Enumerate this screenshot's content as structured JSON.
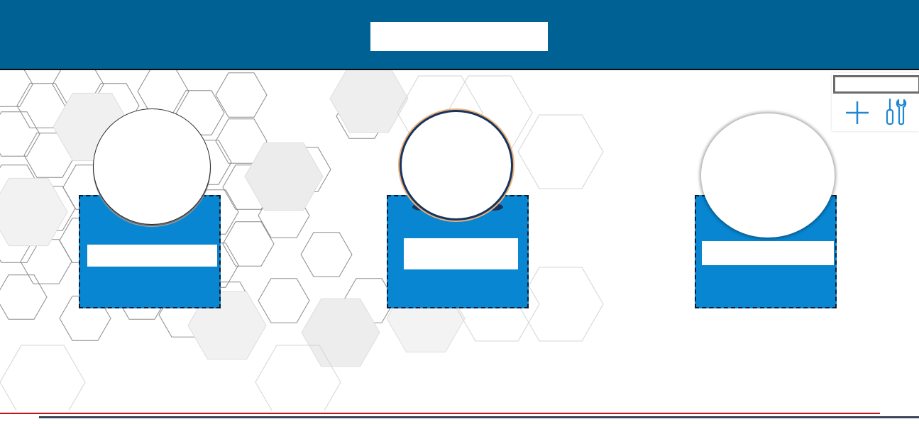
{
  "header": {
    "title": ""
  },
  "tools": {
    "panel_label": "",
    "add_icon": "plus-icon",
    "settings_icon": "tools-icon",
    "accent_color": "#1e88d2"
  },
  "tiles": [
    {
      "label": ""
    },
    {
      "label": ""
    },
    {
      "label": ""
    }
  ],
  "colors": {
    "header_bg": "#006194",
    "tile_bg": "#0886d1",
    "footer_red": "#c0141c",
    "footer_dark": "#3a4556"
  }
}
